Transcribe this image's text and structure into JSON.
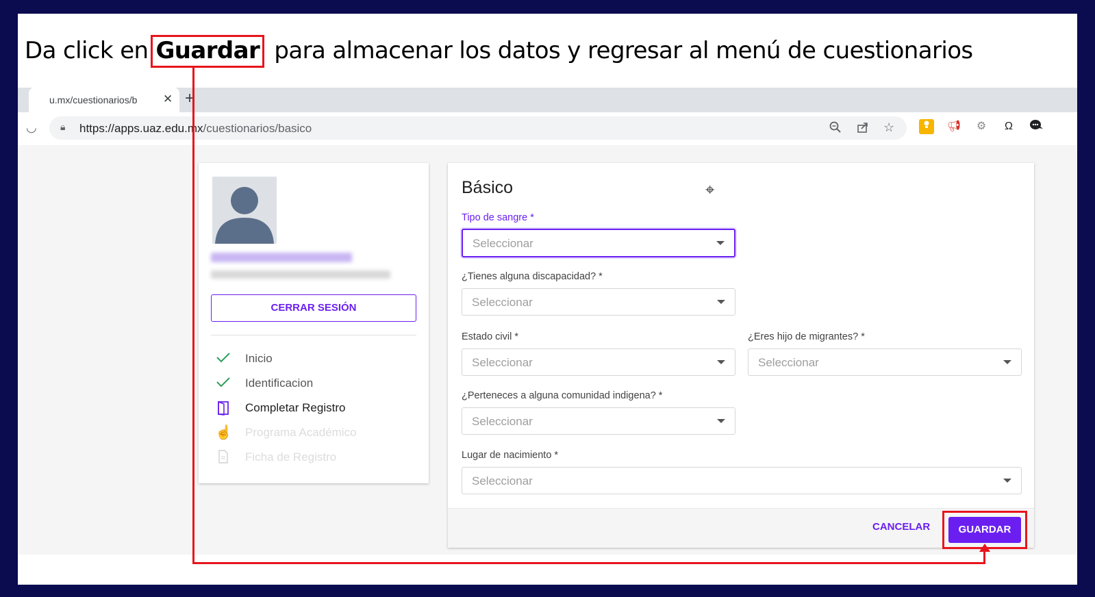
{
  "instruction": {
    "prefix": "Da click en",
    "highlight": "Guardar",
    "suffix": "para almacenar los datos y regresar al menú de cuestionarios"
  },
  "browser": {
    "tab_title": "u.mx/cuestionarios/b",
    "tab_close": "✕",
    "new_tab": "+",
    "url_host": "https://apps.uaz.edu.mx",
    "url_path": "/cuestionarios/basico"
  },
  "user_card": {
    "logout_label": "CERRAR SESIÓN",
    "steps": [
      {
        "label": "Inicio",
        "state": "done"
      },
      {
        "label": "Identificacion",
        "state": "done"
      },
      {
        "label": "Completar Registro",
        "state": "current"
      },
      {
        "label": "Programa Académico",
        "state": "disabled"
      },
      {
        "label": "Ficha de Registro",
        "state": "disabled"
      }
    ]
  },
  "form": {
    "title": "Básico",
    "fields": [
      {
        "label": "Tipo de sangre *",
        "placeholder": "Seleccionar"
      },
      {
        "label": "¿Tienes alguna discapacidad? *",
        "placeholder": "Seleccionar"
      },
      {
        "label": "Estado civil *",
        "placeholder": "Seleccionar"
      },
      {
        "label": "¿Eres hijo de migrantes? *",
        "placeholder": "Seleccionar"
      },
      {
        "label": "¿Perteneces a alguna comunidad indigena? *",
        "placeholder": "Seleccionar"
      },
      {
        "label": "Lugar de nacimiento *",
        "placeholder": "Seleccionar"
      }
    ],
    "cancel_label": "CANCELAR",
    "save_label": "GUARDAR"
  },
  "colors": {
    "accent": "#6a1ff0",
    "annotation_red": "#e8141c",
    "slide_border": "#0b0b50",
    "done_check": "#2e9e5b"
  }
}
